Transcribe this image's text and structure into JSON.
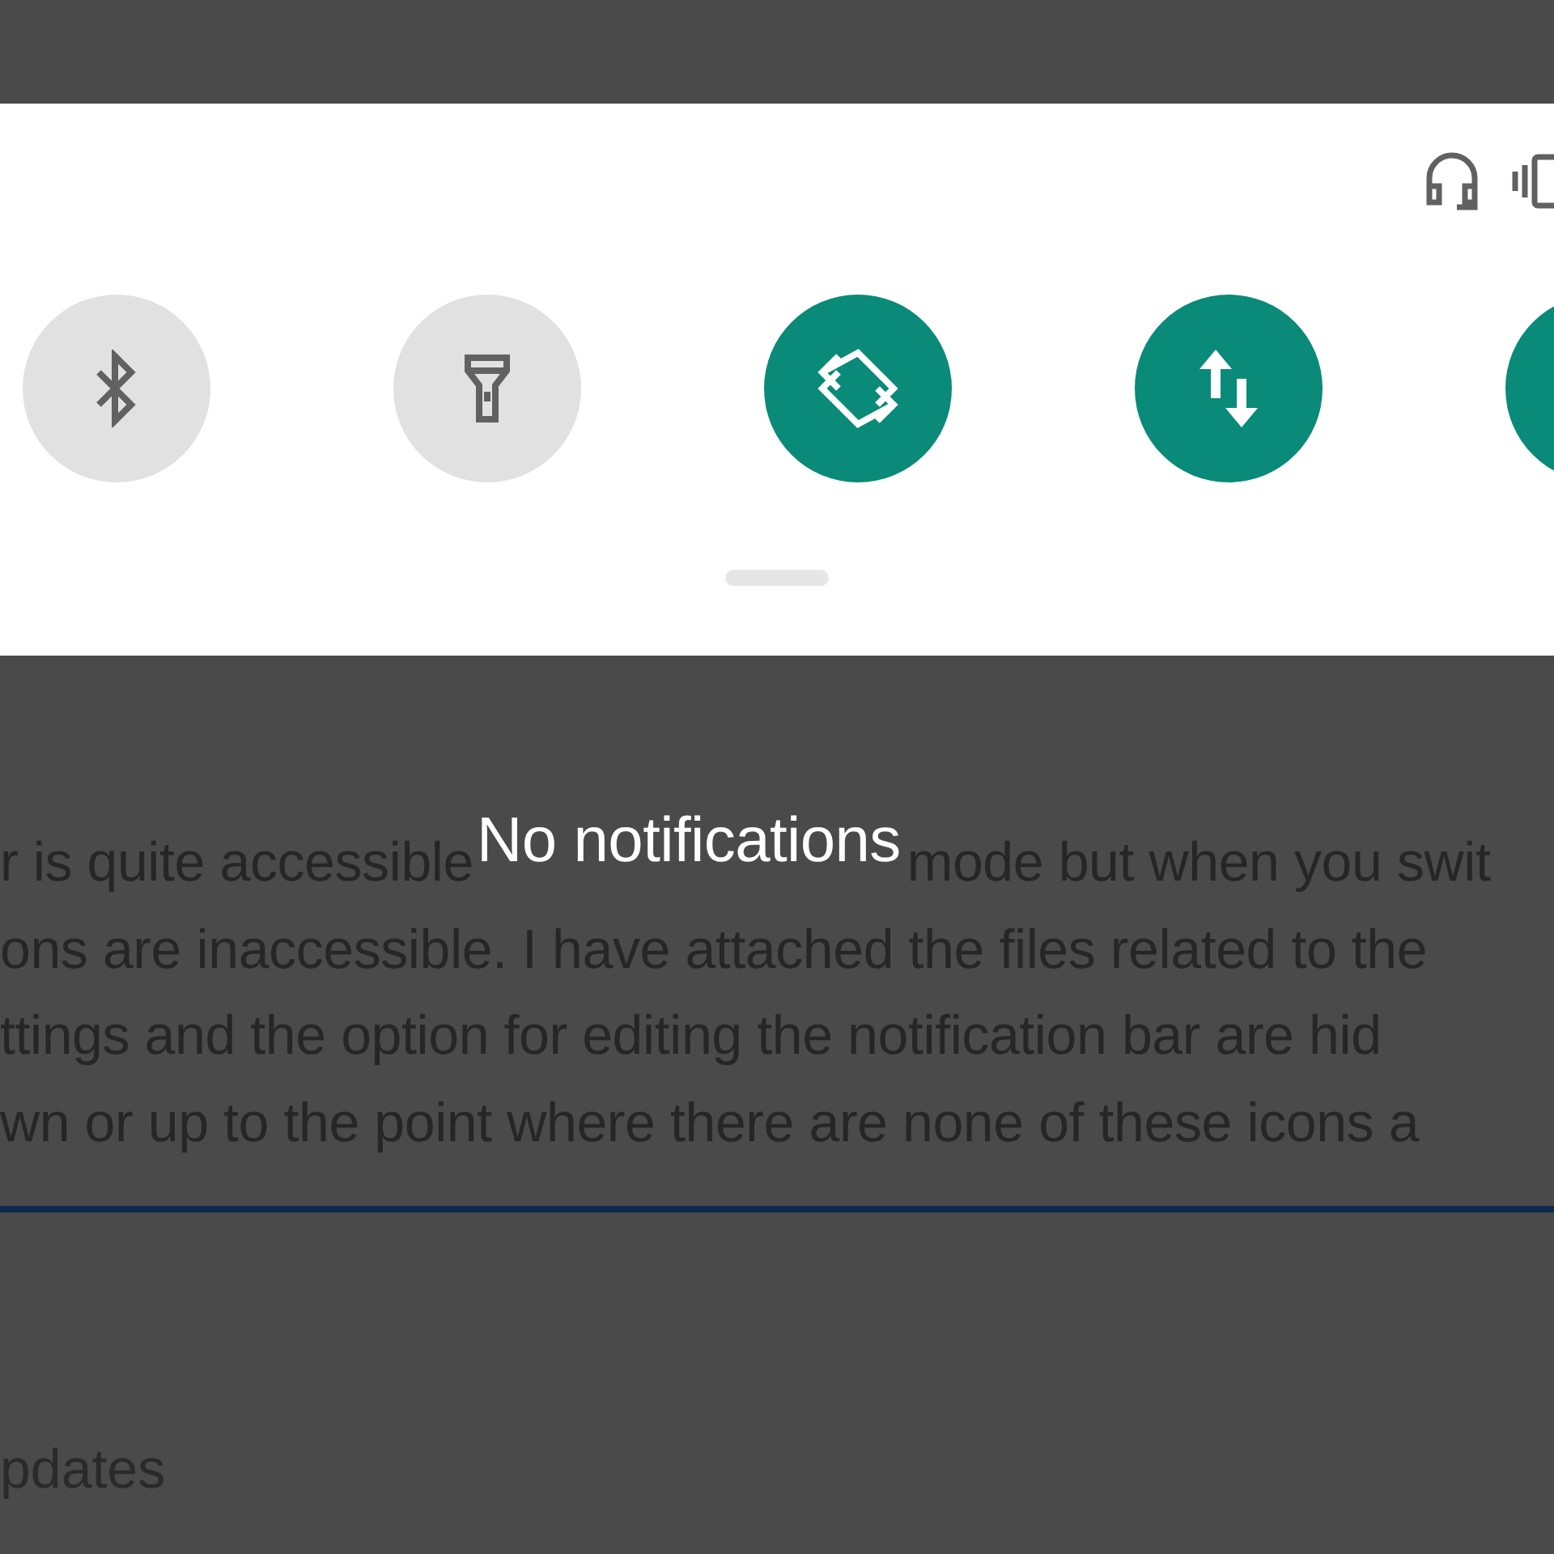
{
  "quick_settings": {
    "tiles": [
      {
        "kind": "bluetooth",
        "on": false
      },
      {
        "kind": "flashlight",
        "on": false
      },
      {
        "kind": "rotate",
        "on": true
      },
      {
        "kind": "data",
        "on": true
      },
      {
        "kind": "blank",
        "on": true
      }
    ]
  },
  "background": {
    "first_line": [
      "r is quite accessible",
      "mode but when you swit"
    ],
    "lines": [
      "ons are inaccessible. I have attached the files related to the",
      "ttings and the option for editing the notification bar are hid",
      "wn or up to the point where there are none of these icons a"
    ],
    "footer": "pdates"
  },
  "empty_message": "No notifications"
}
